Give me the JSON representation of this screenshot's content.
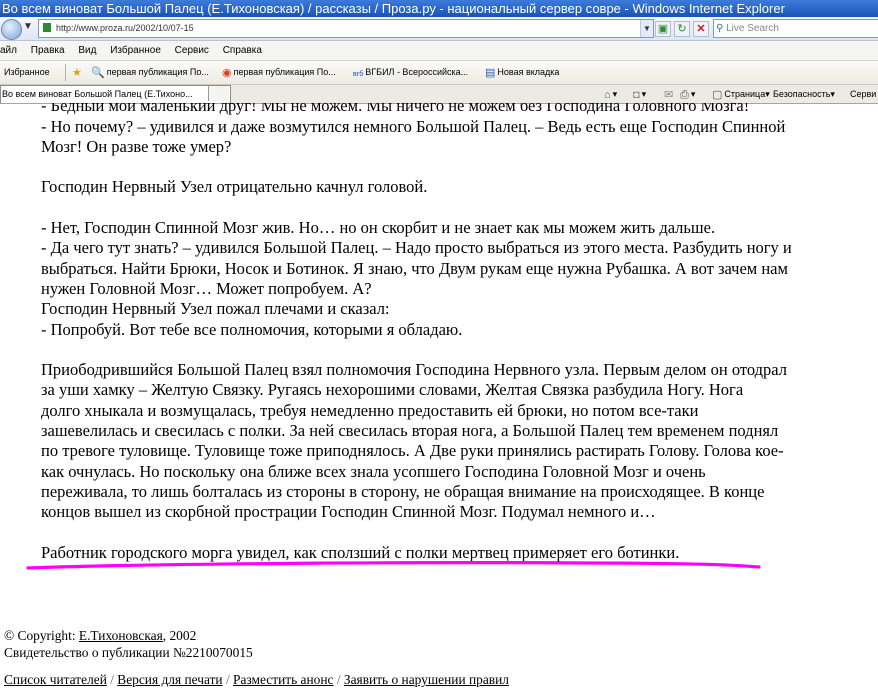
{
  "window": {
    "title": "Во всем виноват Большой Палец (Е.Тихоновская) / рассказы / Проза.ру - национальный сервер совре - Windows Internet Explorer"
  },
  "addressbar": {
    "url": "http://www.proza.ru/2002/10/07-15",
    "search_placeholder": "Live Search"
  },
  "menu": [
    "айл",
    "Правка",
    "Вид",
    "Избранное",
    "Сервис",
    "Справка"
  ],
  "favorites": {
    "label": "Избранное",
    "links": [
      "первая публикация По...",
      "первая публикация По...",
      "ВГБИЛ - Всероссийска...",
      "Новая вкладка"
    ]
  },
  "tab": {
    "title": "Во всем виноват Большой Палец (Е.Тихоно..."
  },
  "commandbar": {
    "page": "Страница",
    "safety": "Безопасность",
    "service": "Серви"
  },
  "story": {
    "lines": [
      "- Бедный мой маленький друг! Мы не можем. Мы ничего не можем без Господина Головного Мозга!",
      "- Но почему? – удивился и даже возмутился немного Большой Палец. – Ведь есть еще Господин Спинной",
      "Мозг! Он разве тоже умер?",
      "Господин Нервный Узел отрицательно качнул головой.",
      "- Нет, Господин Спинной Мозг жив. Но… но он скорбит и не знает как мы можем жить дальше.",
      "- Да чего тут знать? – удивился Большой Палец. – Надо просто выбраться из этого места. Разбудить ногу и",
      "выбраться. Найти Брюки, Носок и Ботинок. Я знаю, что Двум рукам еще нужна Рубашка. А вот зачем нам",
      "нужен Головной Мозг… Может попробуем. А?",
      "Господин Нервный Узел пожал плечами и сказал:",
      "- Попробуй. Вот тебе все полномочия, которыми я обладаю.",
      "Приободрившийся Большой Палец взял полномочия Господина Нервного узла. Первым делом он отодрал",
      "за уши хамку – Желтую Связку. Ругаясь нехорошими словами, Желтая Связка разбудила Ногу. Нога",
      "долго хныкала и возмущалась, требуя немедленно предоставить ей брюки, но потом все-таки",
      "зашевелилась и свесилась с полки. За ней свесилась вторая нога, а Большой Палец тем временем поднял",
      "по тревоге туловище. Туловище тоже приподнялось. А Две руки принялись растирать Голову. Голова кое-",
      "как очнулась. Но поскольку она ближе всех знала усопшего Господина Головной Мозг и очень",
      "переживала, то лишь болталась из стороны в сторону, не обращая внимание на происходящее. В конце",
      "концов вышел из скорбной прострации Господин Спинной Мозг. Подумал немного и…",
      "Работник городского морга увидел, как сползший с полки мертвец примеряет его ботинки."
    ]
  },
  "footer": {
    "copyright_prefix": "© Copyright: ",
    "author": "Е.Тихоновская",
    "year": ", 2002",
    "certificate": "Свидетельство о публикации №2210070015",
    "links": [
      "Список читателей",
      "Версия для печати",
      "Разместить анонс",
      "Заявить о нарушении правил"
    ],
    "separator": " / "
  },
  "colors": {
    "highlight": "#ff00ff",
    "titlebar": "#2a62c9"
  }
}
